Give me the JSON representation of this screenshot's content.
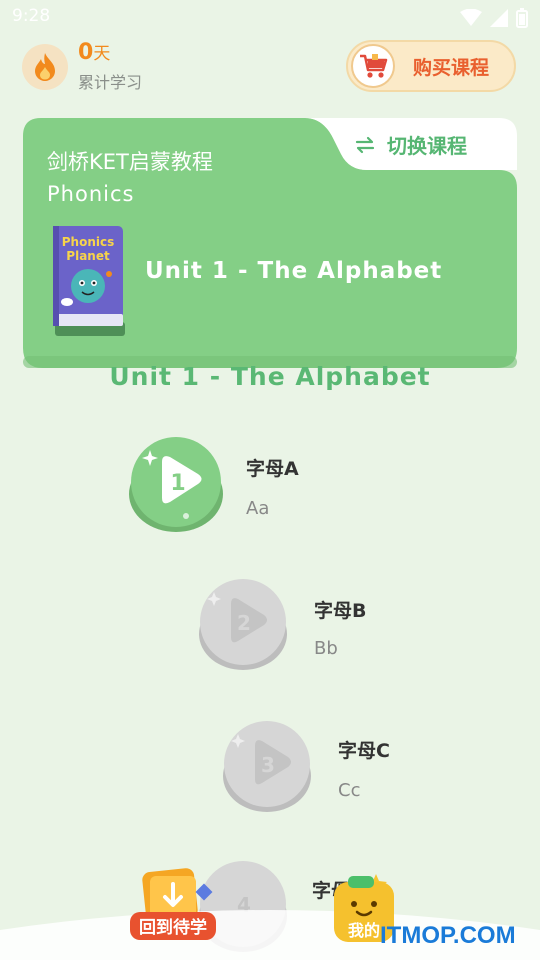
{
  "status_bar": {
    "time": "9:28"
  },
  "header": {
    "streak_days": "0",
    "streak_unit": "天",
    "streak_label": "累计学习",
    "buy_label": "购买课程"
  },
  "course_card": {
    "title": "剑桥KET启蒙教程",
    "subtitle": "Phonics",
    "switch_label": "切换课程",
    "book_title_line1": "Phonics",
    "book_title_line2": "Planet",
    "unit_name": "Unit 1 - The Alphabet"
  },
  "section_title": "Unit 1 - The Alphabet",
  "lessons": [
    {
      "number": "1",
      "name": "字母A",
      "sub": "Aa",
      "state": "active"
    },
    {
      "number": "2",
      "name": "字母B",
      "sub": "Bb",
      "state": "locked"
    },
    {
      "number": "3",
      "name": "字母C",
      "sub": "Cc",
      "state": "locked"
    },
    {
      "number": "4",
      "name": "字母",
      "sub": "",
      "state": "locked"
    }
  ],
  "bottom_bar": {
    "back_label": "回到待学",
    "mine_label": "我的"
  },
  "watermark": "ITMOP.COM",
  "colors": {
    "accent_green": "#84cf86",
    "title_green": "#5ab874",
    "flame_orange": "#f28a1d",
    "buy_red": "#e9602f"
  }
}
